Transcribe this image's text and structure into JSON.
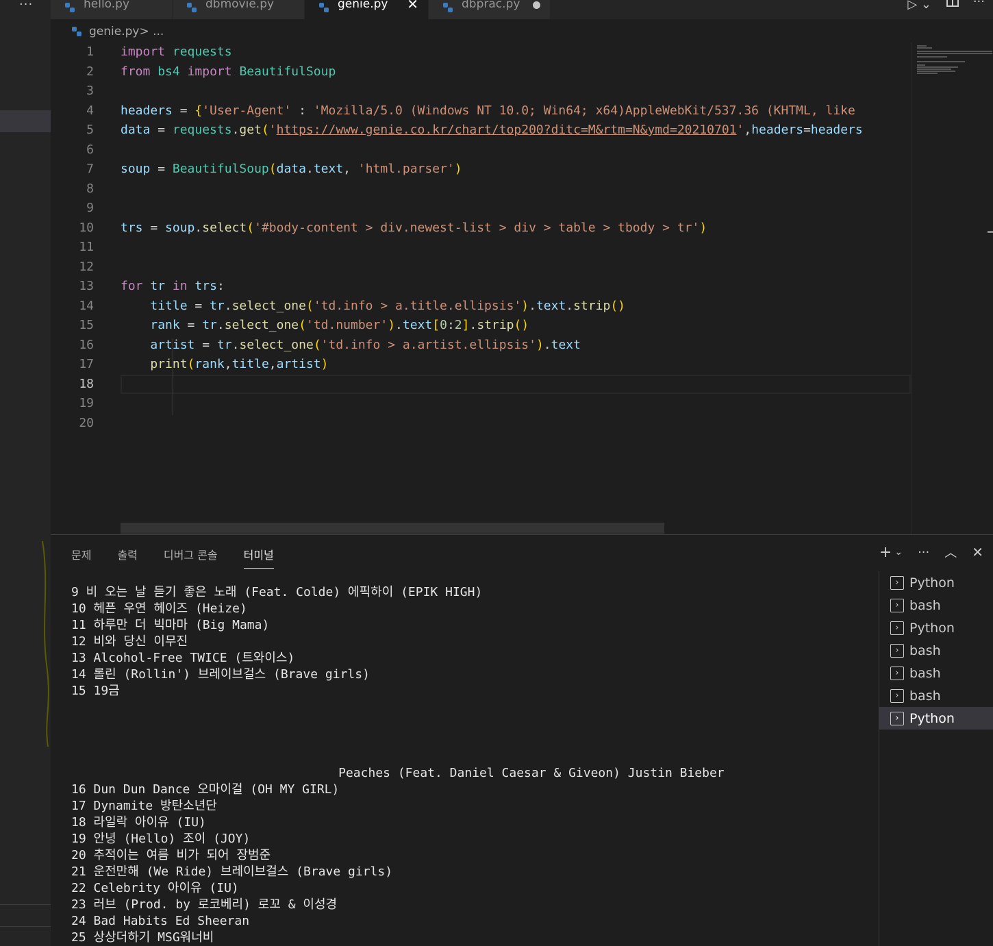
{
  "left_more": "···",
  "tabs": [
    {
      "label": "hello.py"
    },
    {
      "label": "dbmovie.py"
    },
    {
      "label": "genie.py",
      "close": "✕"
    },
    {
      "label": "dbprac.py"
    }
  ],
  "breadcrumb": {
    "file": "genie.py",
    "sep": " > ..."
  },
  "editor": {
    "current_line": 18,
    "line_numbers": [
      "1",
      "2",
      "3",
      "4",
      "5",
      "6",
      "7",
      "8",
      "9",
      "10",
      "11",
      "12",
      "13",
      "14",
      "15",
      "16",
      "17",
      "18",
      "19",
      "20"
    ]
  },
  "panel": {
    "tabs": [
      "문제",
      "출력",
      "디버그 콘솔",
      "터미널"
    ],
    "active_tab": "터미널",
    "terminal_lines": [
      "9 비 오는 날 듣기 좋은 노래 (Feat. Colde) 에픽하이 (EPIK HIGH)",
      "10 헤픈 우연 헤이즈 (Heize)",
      "11 하루만 더 빅마마 (Big Mama)",
      "12 비와 당신 이무진",
      "13 Alcohol-Free TWICE (트와이스)",
      "14 롤린 (Rollin') 브레이브걸스 (Brave girls)",
      "15 19금",
      "",
      "",
      "",
      "",
      "                                    Peaches (Feat. Daniel Caesar & Giveon) Justin Bieber",
      "16 Dun Dun Dance 오마이걸 (OH MY GIRL)",
      "17 Dynamite 방탄소년단",
      "18 라일락 아이유 (IU)",
      "19 안녕 (Hello) 조이 (JOY)",
      "20 추적이는 여름 비가 되어 장범준",
      "21 운전만해 (We Ride) 브레이브걸스 (Brave girls)",
      "22 Celebrity 아이유 (IU)",
      "23 러브 (Prod. by 로코베리) 로꼬 & 이성경",
      "24 Bad Habits Ed Sheeran",
      "25 상상더하기 MSG워너비"
    ],
    "terminals": [
      "Python",
      "bash",
      "Python",
      "bash",
      "bash",
      "bash",
      "Python"
    ],
    "active_terminal": 6
  }
}
